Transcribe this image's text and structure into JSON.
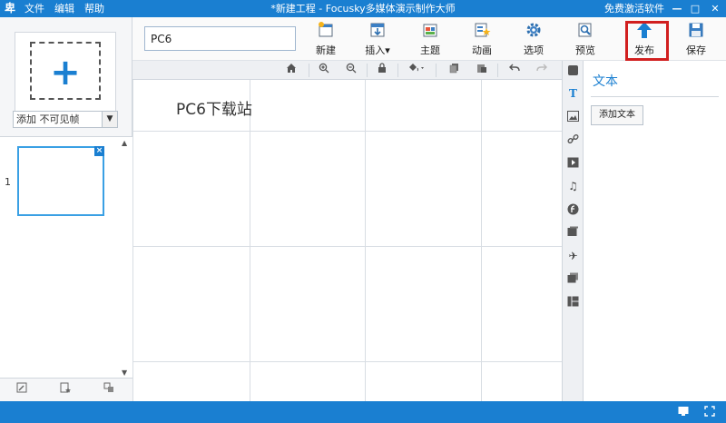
{
  "titlebar": {
    "app_icon": "卑",
    "menu": [
      "文件",
      "编辑",
      "帮助"
    ],
    "title": "*新建工程 - Focusky多媒体演示制作大师",
    "free_link": "免费激活软件",
    "minimize": "—",
    "maximize": "□",
    "close": "✕"
  },
  "toolbar": {
    "project_name": "PC6",
    "buttons": [
      {
        "label": "新建",
        "icon": "new-icon"
      },
      {
        "label": "插入",
        "icon": "insert-icon",
        "dropdown": "▾"
      },
      {
        "label": "主题",
        "icon": "theme-icon"
      },
      {
        "label": "动画",
        "icon": "animation-icon"
      },
      {
        "label": "选项",
        "icon": "options-gear-icon"
      },
      {
        "label": "预览",
        "icon": "preview-icon"
      },
      {
        "label": "发布",
        "icon": "publish-upload-icon"
      },
      {
        "label": "保存",
        "icon": "save-icon"
      }
    ]
  },
  "left": {
    "add_plus": "+",
    "frame_select": "添加 不可见帧",
    "slide_number": "1",
    "slide_close": "×"
  },
  "canvas": {
    "text": "PC6下载站"
  },
  "props": {
    "title": "文本",
    "add_text_button": "添加文本"
  },
  "colors": {
    "accent": "#1a7fd1",
    "highlight": "#d11f1f"
  }
}
